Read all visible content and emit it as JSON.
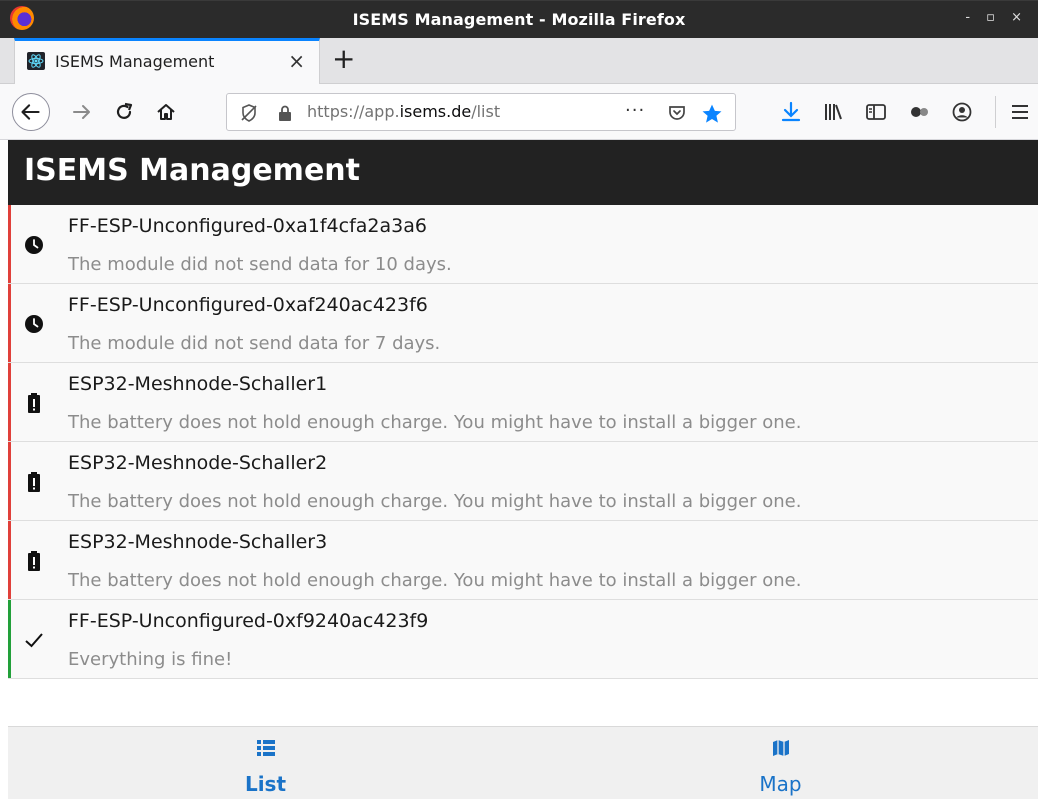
{
  "window": {
    "title": "ISEMS Management - Mozilla Firefox",
    "controls": "- ▫ ×"
  },
  "browser": {
    "tab": {
      "title": "ISEMS Management",
      "close": "×"
    },
    "new_tab": "+",
    "url": {
      "prefix": "https://app.",
      "domain": "isems.de",
      "path": "/list"
    },
    "more": "···"
  },
  "app": {
    "title": "ISEMS Management",
    "colors": {
      "header_bg": "#222222",
      "error": "#e0403a",
      "ok": "#22a03a"
    }
  },
  "modules": [
    {
      "name": "FF-ESP-Unconfigured-0xa1f4cfa2a3a6",
      "message": "The module did not send data for 10 days.",
      "icon": "clock-icon",
      "status": "error"
    },
    {
      "name": "FF-ESP-Unconfigured-0xaf240ac423f6",
      "message": "The module did not send data for 7 days.",
      "icon": "clock-icon",
      "status": "error"
    },
    {
      "name": "ESP32-Meshnode-Schaller1",
      "message": "The battery does not hold enough charge. You might have to install a bigger one.",
      "icon": "battery-alert-icon",
      "status": "error"
    },
    {
      "name": "ESP32-Meshnode-Schaller2",
      "message": "The battery does not hold enough charge. You might have to install a bigger one.",
      "icon": "battery-alert-icon",
      "status": "error"
    },
    {
      "name": "ESP32-Meshnode-Schaller3",
      "message": "The battery does not hold enough charge. You might have to install a bigger one.",
      "icon": "battery-alert-icon",
      "status": "error"
    },
    {
      "name": "FF-ESP-Unconfigured-0xf9240ac423f9",
      "message": "Everything is fine!",
      "icon": "check-icon",
      "status": "ok"
    }
  ],
  "bottom_nav": {
    "tabs": [
      {
        "label": "List",
        "icon": "list-icon",
        "active": true
      },
      {
        "label": "Map",
        "icon": "map-icon",
        "active": false
      }
    ],
    "active_color": "#1a73c8",
    "inactive_color": "#1a73c8"
  }
}
